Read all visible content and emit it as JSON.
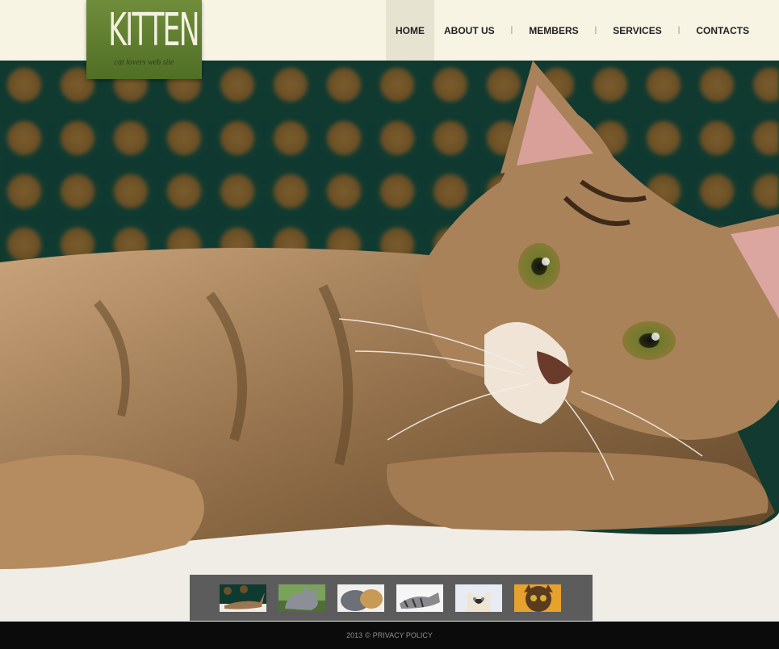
{
  "brand": {
    "title": "KITTEN",
    "tagline": "cat lovers web site"
  },
  "nav": {
    "items": [
      {
        "label": "HOME",
        "active": true
      },
      {
        "label": "ABOUT US"
      },
      {
        "label": "MEMBERS"
      },
      {
        "label": "SERVICES"
      },
      {
        "label": "CONTACTS"
      }
    ]
  },
  "gallery": {
    "thumbnails": [
      "cat-thumb-1",
      "cat-thumb-2",
      "cat-thumb-3",
      "cat-thumb-4",
      "cat-thumb-5",
      "cat-thumb-6"
    ]
  },
  "footer": {
    "year": "2013",
    "copyright_symbol": "©",
    "privacy": "PRIVACY POLICY"
  }
}
